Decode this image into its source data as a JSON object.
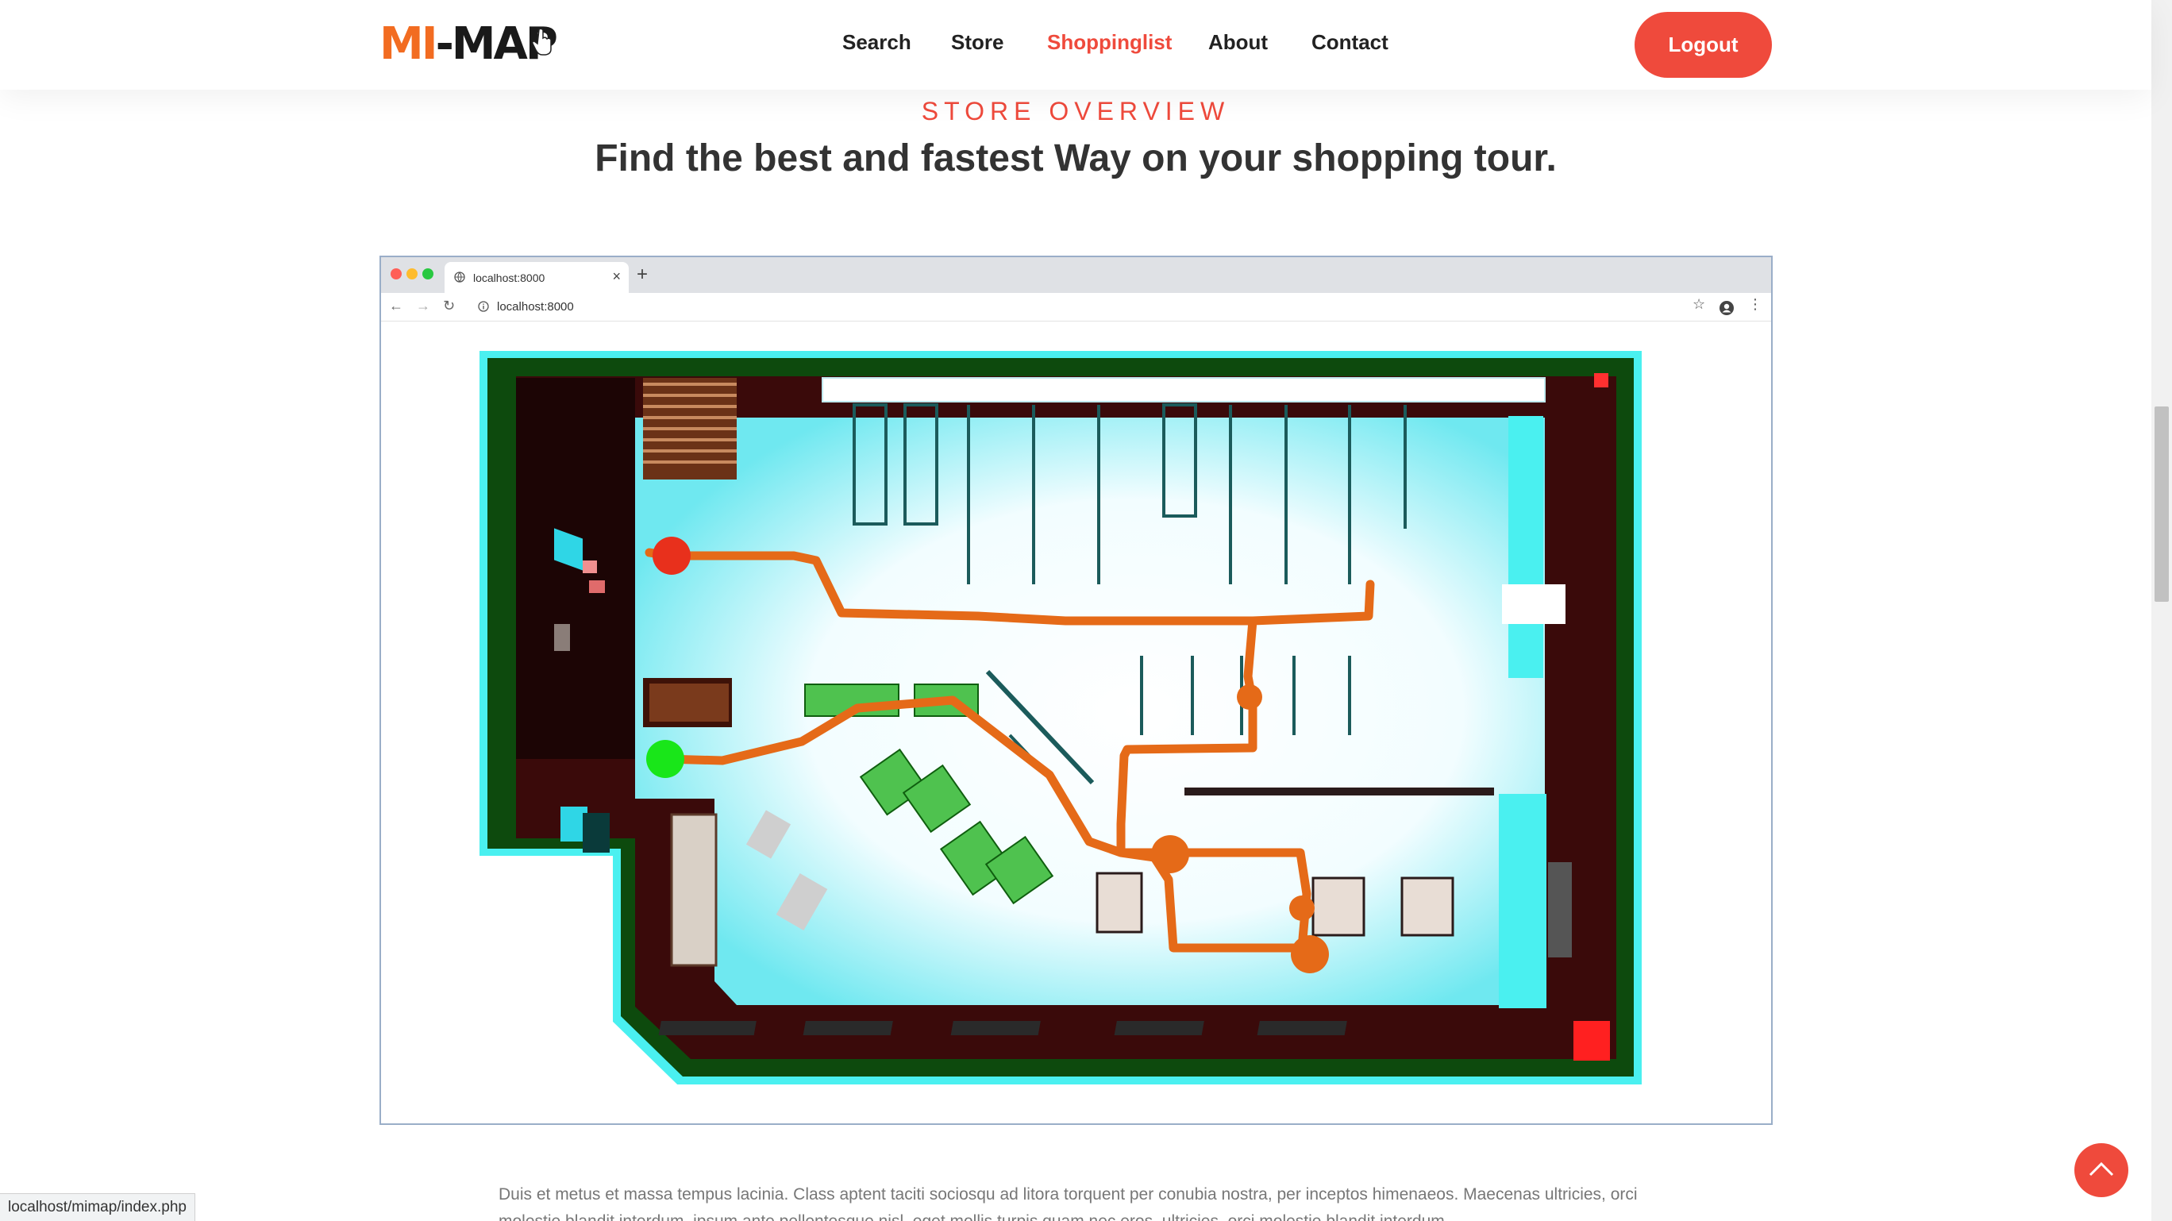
{
  "app": {
    "logo_text_a": "MI",
    "logo_text_b": "-MAP",
    "brand_color": "#ef4a3c",
    "logo_accent_color": "#f26c21"
  },
  "nav": {
    "items": [
      {
        "label": "Search"
      },
      {
        "label": "Store"
      },
      {
        "label": "Shoppinglist",
        "active": true
      },
      {
        "label": "About"
      },
      {
        "label": "Contact"
      }
    ],
    "logout_label": "Logout"
  },
  "section": {
    "overline": "STORE OVERVIEW",
    "headline_bold": "Find the best and fastest Way",
    "headline_rest": " on your shopping tour."
  },
  "browser": {
    "tab_title": "localhost:8000",
    "address": "localhost:8000",
    "icons": [
      "back-arrow-icon",
      "forward-arrow-icon",
      "reload-icon",
      "info-icon",
      "star-icon",
      "account-icon",
      "menu-dots-icon"
    ]
  },
  "map": {
    "description_colors": {
      "wall": "#0d4a0d",
      "wall_outline": "#4af0f0",
      "floor_dark": "#3a0a0a",
      "route": "#e56a18",
      "start_marker": "#19e619",
      "end_marker": "#e8301c",
      "shelf_green": "#4fc24f"
    }
  },
  "body": {
    "paragraph": "Duis et metus et massa tempus lacinia. Class aptent taciti sociosqu ad litora torquent per conubia nostra, per inceptos himenaeos. Maecenas ultricies, orci molestie blandit interdum, ipsum ante pellentesque nisl, eget mollis turpis quam nec eros. ultricies, orci molestie blandit interdum"
  },
  "status_bar": {
    "url": "localhost/mimap/index.php"
  }
}
